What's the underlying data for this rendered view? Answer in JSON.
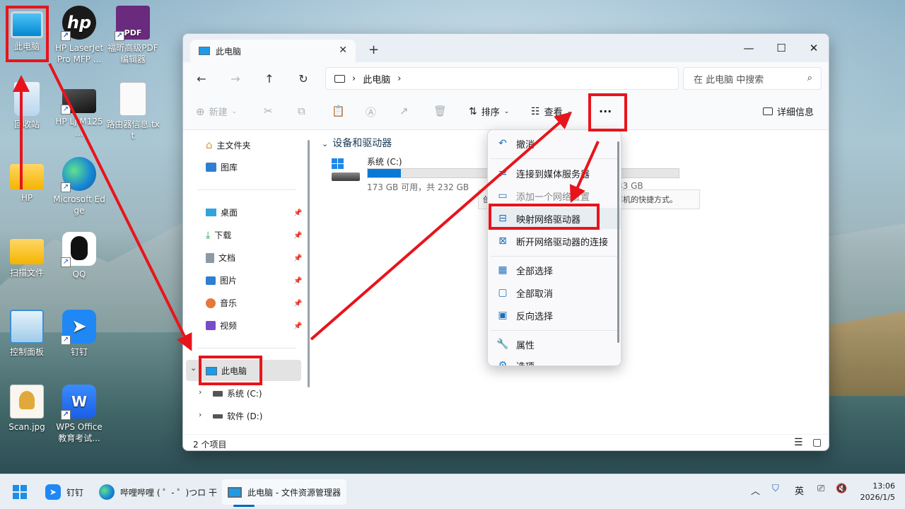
{
  "desktop": {
    "icons": [
      {
        "label": "此电脑",
        "kind": "monitor"
      },
      {
        "label": "HP LaserJet Pro MFP ...",
        "kind": "hp"
      },
      {
        "label": "福昕高级PDF编辑器",
        "kind": "pdf"
      },
      {
        "label": "回收站",
        "kind": "recycle"
      },
      {
        "label": "HP LJ M125 ...",
        "kind": "scanner"
      },
      {
        "label": "路由器信息.txt",
        "kind": "txt"
      },
      {
        "label": "HP",
        "kind": "folder"
      },
      {
        "label": "Microsoft Edge",
        "kind": "edge"
      },
      {
        "label": "扫描文件",
        "kind": "folder2"
      },
      {
        "label": "QQ",
        "kind": "qq"
      },
      {
        "label": "控制面板",
        "kind": "control"
      },
      {
        "label": "钉钉",
        "kind": "dingtalk"
      },
      {
        "label": "Scan.jpg",
        "kind": "image"
      },
      {
        "label": "WPS Office 教育考试...",
        "kind": "wps"
      }
    ]
  },
  "window": {
    "tab_title": "此电脑",
    "new_tab": "+",
    "controls": {
      "minimize": "—",
      "maximize": "☐",
      "close": "✕"
    },
    "breadcrumb": {
      "current": "此电脑",
      "sep": "›"
    },
    "search_placeholder": "在 此电脑 中搜索",
    "toolbar": {
      "new": "新建",
      "sort": "排序",
      "view": "查看",
      "more": "···",
      "details": "详细信息"
    },
    "sidebar": {
      "home": "主文件夹",
      "gallery": "图库",
      "pinned": [
        "桌面",
        "下载",
        "文档",
        "图片",
        "音乐",
        "视频"
      ],
      "this_pc": "此电脑",
      "drives": [
        "系统 (C:)",
        "软件 (D:)"
      ]
    },
    "main": {
      "group_title": "设备和驱动器",
      "drive_c": {
        "name": "系统 (C:)",
        "info": "173 GB 可用，共 232 GB",
        "used_fraction": 0.25
      },
      "drive_d_info_partial": "33 GB"
    },
    "status": "2 个项目"
  },
  "menu": {
    "items": [
      {
        "label": "撤消",
        "icon": "↶"
      },
      {
        "label": "连接到媒体服务器",
        "icon": "⇄"
      },
      {
        "label": "添加一个网络位置",
        "icon": "▭"
      },
      {
        "label": "映射网络驱动器",
        "icon": "⊟"
      },
      {
        "label": "断开网络驱动器的连接",
        "icon": "⊠"
      },
      {
        "label": "全部选择",
        "icon": "▦"
      },
      {
        "label": "全部取消",
        "icon": "▢"
      },
      {
        "label": "反向选择",
        "icon": "▣"
      },
      {
        "label": "属性",
        "icon": "🔧"
      },
      {
        "label": "选项",
        "icon": "⚙"
      }
    ],
    "tooltip": "创建一个指向网络上的共享文件夹或计算机的快捷方式。"
  },
  "taskbar": {
    "dingtalk": "钉钉",
    "edge_tab": "哔哩哔哩 ( ゜- ゜)つロ 干",
    "explorer": "此电脑 - 文件资源管理器",
    "ime": "英",
    "time": "13:06",
    "date": "2026/1/5"
  },
  "colors": {
    "annotation": "#e8141b",
    "accent": "#0067c0"
  }
}
